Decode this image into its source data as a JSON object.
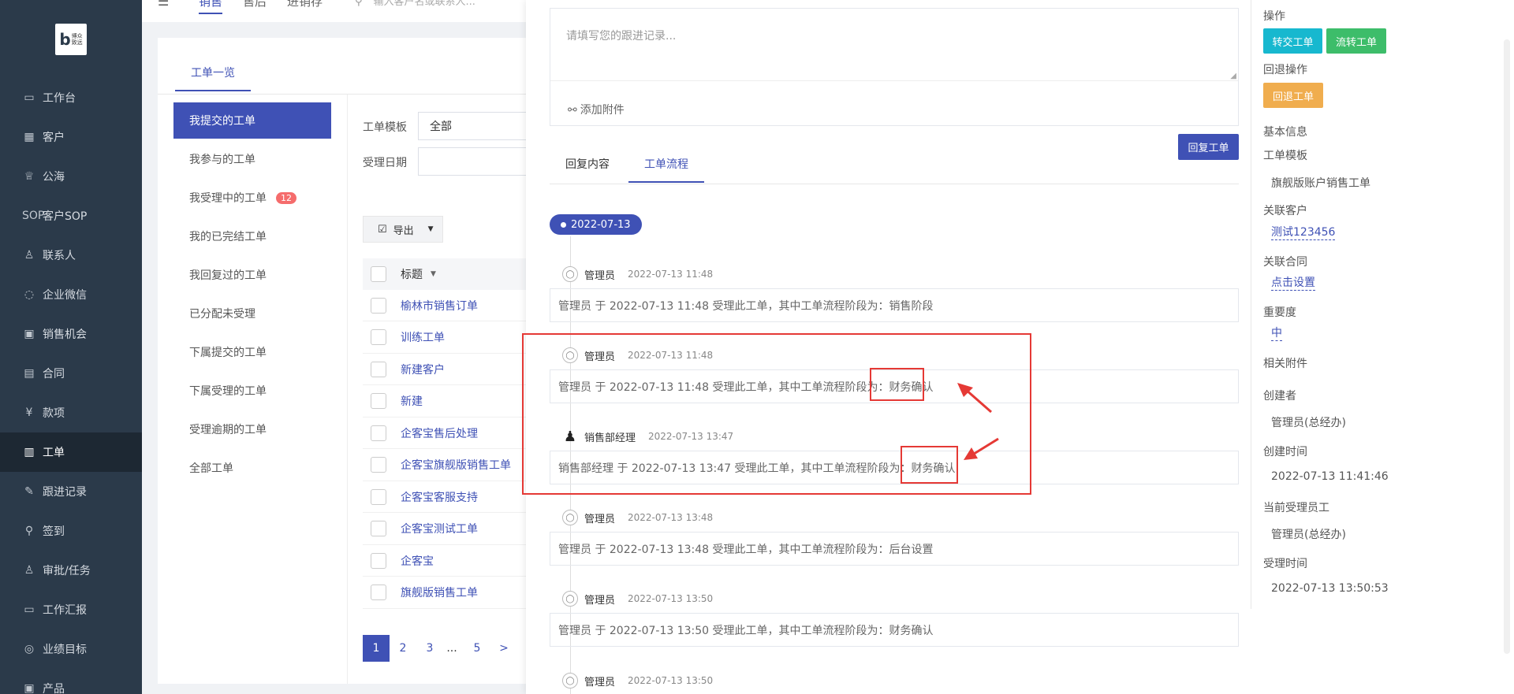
{
  "logo": {
    "letter": "b",
    "line1": "博众",
    "line2": "致远"
  },
  "sidebar": {
    "items": [
      {
        "label": "工作台",
        "icon": "▭"
      },
      {
        "label": "客户",
        "icon": "▦"
      },
      {
        "label": "公海",
        "icon": "♕"
      },
      {
        "label": "客户SOP",
        "icon": "SOP"
      },
      {
        "label": "联系人",
        "icon": "♙"
      },
      {
        "label": "企业微信",
        "icon": "◌"
      },
      {
        "label": "销售机会",
        "icon": "▣"
      },
      {
        "label": "合同",
        "icon": "▤"
      },
      {
        "label": "款项",
        "icon": "¥"
      },
      {
        "label": "工单",
        "icon": "▥"
      },
      {
        "label": "跟进记录",
        "icon": "✎"
      },
      {
        "label": "签到",
        "icon": "⚲"
      },
      {
        "label": "审批/任务",
        "icon": "♙"
      },
      {
        "label": "工作汇报",
        "icon": "▭"
      },
      {
        "label": "业绩目标",
        "icon": "◎"
      },
      {
        "label": "产品",
        "icon": "▣"
      }
    ],
    "active_index": 9
  },
  "topbar": {
    "menu_icon": "☰",
    "tabs": [
      "销售",
      "售后",
      "进销存"
    ],
    "search_placeholder": "输入客户名或联系人..."
  },
  "main": {
    "tab_label": "工单一览",
    "left_menu": [
      {
        "label": "我提交的工单"
      },
      {
        "label": "我参与的工单"
      },
      {
        "label": "我受理中的工单",
        "badge": "12"
      },
      {
        "label": "我的已完结工单"
      },
      {
        "label": "我回复过的工单"
      },
      {
        "label": "已分配未受理"
      },
      {
        "label": "下属提交的工单"
      },
      {
        "label": "下属受理的工单"
      },
      {
        "label": "受理逾期的工单"
      },
      {
        "label": "全部工单"
      }
    ],
    "filters": {
      "template_label": "工单模板",
      "template_value": "全部",
      "date_label": "受理日期",
      "date_value": ""
    },
    "export_label": "导出",
    "table": {
      "header": "标题",
      "rows": [
        "榆林市销售订单",
        "训练工单",
        "新建客户",
        "新建",
        "企客宝售后处理",
        "企客宝旗舰版销售工单",
        "企客宝客服支持",
        "企客宝测试工单",
        "企客宝",
        "旗舰版销售工单"
      ]
    },
    "pagination": [
      "1",
      "2",
      "3",
      "...",
      "5",
      ">"
    ]
  },
  "drawer": {
    "reply_placeholder": "请填写您的跟进记录...",
    "attach_label": "添加附件",
    "reply_button": "回复工单",
    "tabs": [
      "回复内容",
      "工单流程"
    ],
    "active_tab": 1,
    "date_pill": "2022-07-13",
    "timeline": [
      {
        "name": "管理员",
        "time": "2022-07-13 11:48",
        "text": "管理员 于 2022-07-13 11:48 受理此工单，其中工单流程阶段为：销售阶段"
      },
      {
        "name": "管理员",
        "time": "2022-07-13 11:48",
        "text": "管理员 于 2022-07-13 11:48 受理此工单，其中工单流程阶段为：财务确认"
      },
      {
        "name": "销售部经理",
        "time": "2022-07-13 13:47",
        "text": "销售部经理 于 2022-07-13 13:47 受理此工单，其中工单流程阶段为：财务确认"
      },
      {
        "name": "管理员",
        "time": "2022-07-13 13:48",
        "text": "管理员 于 2022-07-13 13:48 受理此工单，其中工单流程阶段为：后台设置"
      },
      {
        "name": "管理员",
        "time": "2022-07-13 13:50",
        "text": "管理员 于 2022-07-13 13:50 受理此工单，其中工单流程阶段为：财务确认"
      },
      {
        "name": "管理员",
        "time": "2022-07-13 13:50",
        "text": ""
      }
    ],
    "info": {
      "ops_label": "操作",
      "transfer_btn": "转交工单",
      "flow_btn": "流转工单",
      "rollback_label": "回退操作",
      "rollback_btn": "回退工单",
      "basic_label": "基本信息",
      "template_label": "工单模板",
      "template_value": "旗舰版账户销售工单",
      "customer_label": "关联客户",
      "customer_value": "测试123456",
      "contract_label": "关联合同",
      "contract_value": "点击设置",
      "priority_label": "重要度",
      "priority_value": "中",
      "attach_label": "相关附件",
      "creator_label": "创建者",
      "creator_value": "管理员(总经办)",
      "created_label": "创建时间",
      "created_value": "2022-07-13 11:41:46",
      "handler_label": "当前受理员工",
      "handler_value": "管理员(总经办)",
      "accepted_label": "受理时间",
      "accepted_value": "2022-07-13 13:50:53"
    },
    "colors": {
      "transfer": "#17b8cf",
      "flow": "#3dbd6a",
      "rollback": "#f0ad4e",
      "accent": "#3f51b5",
      "highlight": "#e53935"
    }
  }
}
